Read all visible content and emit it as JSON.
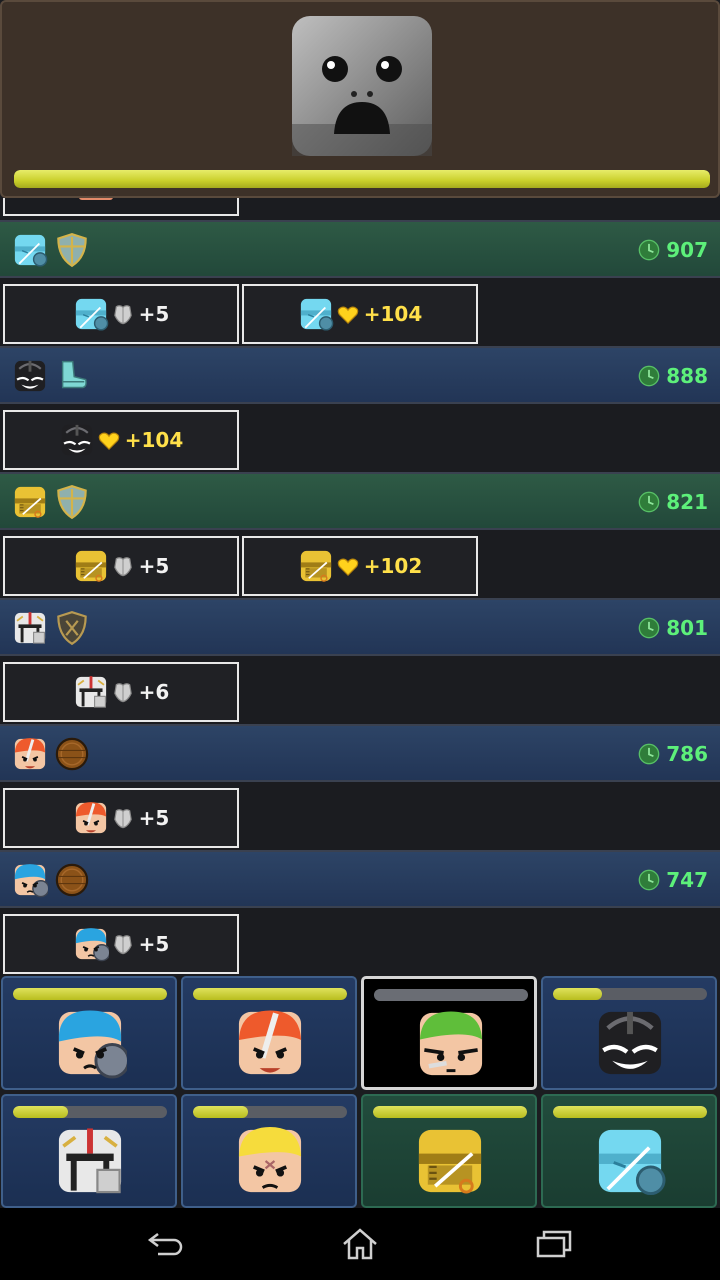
{
  "boss": {
    "icon": "stone-face-boss",
    "hp_fraction": 1.0
  },
  "log": {
    "entries": [
      {
        "hero": "cyan-robot",
        "item": "shield-item",
        "color": "green",
        "score": "907",
        "rewards": [
          {
            "hero": "cyan-robot",
            "type": "armor",
            "value": "+5"
          },
          {
            "hero": "cyan-robot",
            "type": "heart",
            "value": "+104"
          }
        ]
      },
      {
        "hero": "dark-knight",
        "item": "boot-item",
        "color": "blue",
        "score": "888",
        "rewards": [
          {
            "hero": "dark-knight",
            "type": "heart",
            "value": "+104"
          }
        ]
      },
      {
        "hero": "gold-robot",
        "item": "shield-item",
        "color": "green",
        "score": "821",
        "rewards": [
          {
            "hero": "gold-robot",
            "type": "armor",
            "value": "+5"
          },
          {
            "hero": "gold-robot",
            "type": "heart",
            "value": "+102"
          }
        ]
      },
      {
        "hero": "white-knight",
        "item": "bronze-shield-item",
        "color": "blue",
        "score": "801",
        "rewards": [
          {
            "hero": "white-knight",
            "type": "armor",
            "value": "+6"
          }
        ]
      },
      {
        "hero": "red-warrior",
        "item": "round-shield-item",
        "color": "blue",
        "score": "786",
        "rewards": [
          {
            "hero": "red-warrior",
            "type": "armor",
            "value": "+5"
          }
        ]
      },
      {
        "hero": "blue-warrior",
        "item": "round-shield-item",
        "color": "blue",
        "score": "747",
        "rewards": [
          {
            "hero": "blue-warrior",
            "type": "armor",
            "value": "+5"
          }
        ]
      }
    ]
  },
  "party": [
    {
      "hero": "blue-warrior",
      "hp": 1.0,
      "state": "normal"
    },
    {
      "hero": "red-warrior",
      "hp": 1.0,
      "state": "normal"
    },
    {
      "hero": "green-warrior",
      "hp": 1.0,
      "state": "selected",
      "hp_color": "gray"
    },
    {
      "hero": "dark-knight",
      "hp": 0.32,
      "state": "normal"
    },
    {
      "hero": "white-knight",
      "hp": 0.36,
      "state": "normal"
    },
    {
      "hero": "blonde-warrior",
      "hp": 0.36,
      "state": "normal"
    },
    {
      "hero": "gold-robot",
      "hp": 1.0,
      "state": "green"
    },
    {
      "hero": "cyan-robot",
      "hp": 1.0,
      "state": "green"
    }
  ],
  "navbar": {
    "buttons": [
      "back-icon",
      "home-icon",
      "recent-apps-icon"
    ]
  },
  "colors": {
    "score_green": "#5df07a",
    "heart_yellow": "#ffe04a",
    "hp_yellow": "#c9cf2a"
  }
}
